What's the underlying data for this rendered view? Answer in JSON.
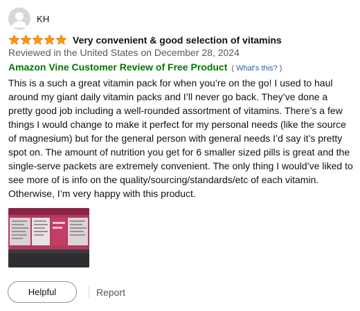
{
  "reviewer": {
    "name": "KH"
  },
  "review": {
    "rating": 5,
    "rating_max": 5,
    "title": "Very convenient & good selection of vitamins",
    "date_line": "Reviewed in the United States on December 28, 2024",
    "vine_label": "Amazon Vine Customer Review of Free Product",
    "whats_this_open": "( ",
    "whats_this_label": "What's this?",
    "whats_this_close": " )",
    "body": "This is a such a great vitamin pack for when you’re on the go! I used to haul around my giant daily vitamin packs and I’ll never go back. They’ve done a pretty good job including a well-rounded assortment of vitamins. There’s a few things I would change to make it perfect for my personal needs (like the source of magnesium) but for the general person with general needs I’d say it’s pretty spot on. The amount of nutrition you get for 6 smaller sized pills is great and the single-serve packets are extremely convenient. The only thing I would’ve liked to see more of is info on the quality/sourcing/standards/etc of each vitamin. Otherwise, I’m very happy with this product."
  },
  "actions": {
    "helpful_label": "Helpful",
    "report_label": "Report"
  },
  "colors": {
    "star": "#ff9900",
    "vine_green": "#007600",
    "link_blue": "#2162a1",
    "muted_text": "#565959"
  },
  "icons": {
    "avatar": "default-person-avatar-icon",
    "star": "star-filled-icon"
  }
}
